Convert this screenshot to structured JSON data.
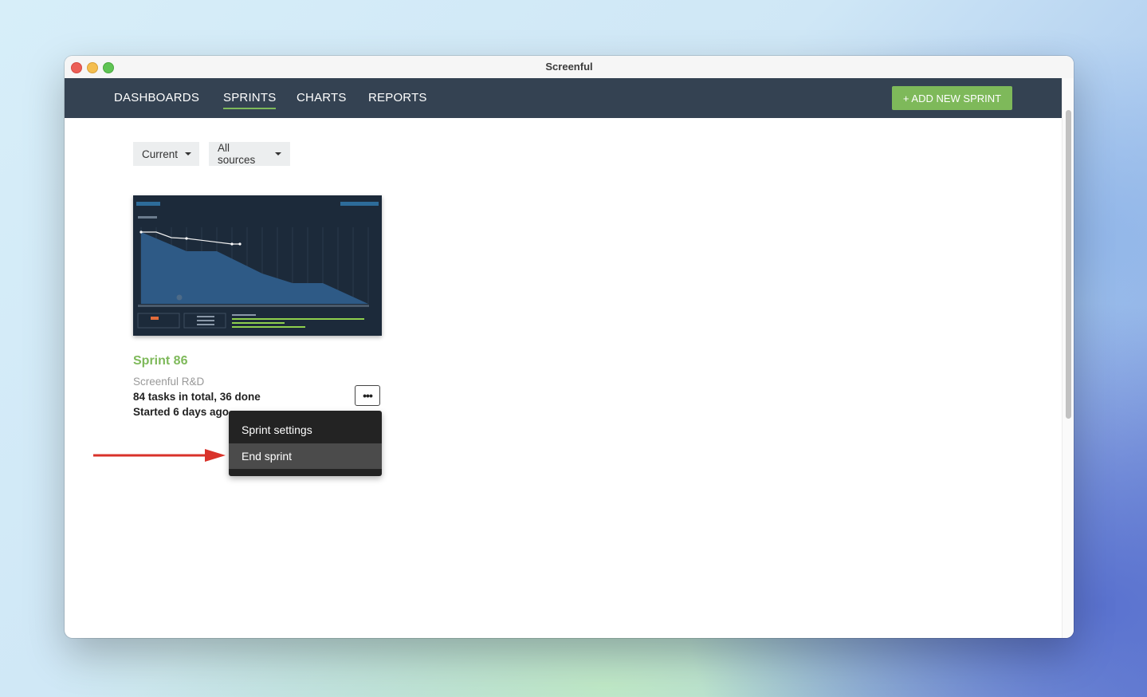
{
  "window": {
    "title": "Screenful"
  },
  "nav": {
    "items": [
      {
        "label": "DASHBOARDS",
        "active": false
      },
      {
        "label": "SPRINTS",
        "active": true
      },
      {
        "label": "CHARTS",
        "active": false
      },
      {
        "label": "REPORTS",
        "active": false
      }
    ],
    "add_button": "+ ADD NEW SPRINT",
    "accent": "#7eb95a",
    "bar_color": "#344252"
  },
  "filters": [
    {
      "label": "Current"
    },
    {
      "label": "All sources"
    }
  ],
  "sprint_card": {
    "title": "Sprint 86",
    "organization": "Screenful R&D",
    "tasks_summary": "84 tasks in total, 36 done",
    "started": "Started 6 days ago"
  },
  "context_menu": {
    "items": [
      {
        "label": "Sprint settings",
        "highlighted": false
      },
      {
        "label": "End sprint",
        "highlighted": true
      }
    ]
  },
  "annotation": {
    "arrow_color": "#d9322a",
    "icon": "arrow-right-icon"
  }
}
